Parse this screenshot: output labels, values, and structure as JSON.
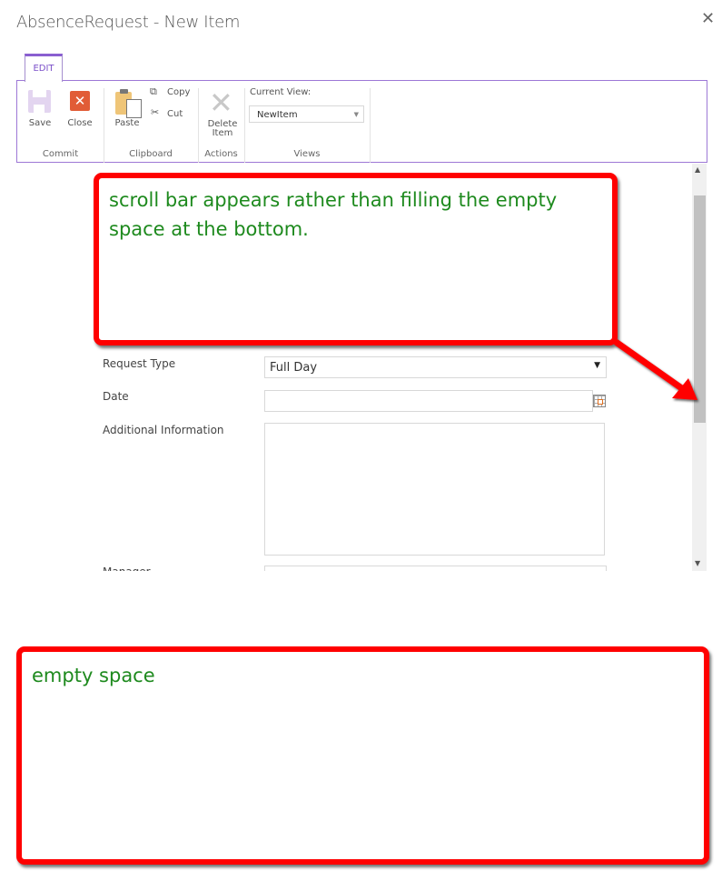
{
  "dialog": {
    "title": "AbsenceRequest - New Item",
    "close_icon": "close-x-icon"
  },
  "ribbon": {
    "active_tab": "EDIT",
    "groups": [
      {
        "label": "Commit",
        "buttons": [
          {
            "label": "Save",
            "icon": "save-icon",
            "enabled": false
          },
          {
            "label": "Close",
            "icon": "close-icon",
            "enabled": true
          }
        ]
      },
      {
        "label": "Clipboard",
        "buttons": [
          {
            "label": "Paste",
            "icon": "paste-icon"
          },
          {
            "label": "Copy",
            "icon": "copy-icon"
          },
          {
            "label": "Cut",
            "icon": "cut-icon"
          }
        ]
      },
      {
        "label": "Actions",
        "buttons": [
          {
            "label": "Delete Item",
            "line1": "Delete",
            "line2": "Item",
            "icon": "delete-icon",
            "enabled": false
          }
        ]
      },
      {
        "label": "Views",
        "current_view_label": "Current View:",
        "current_view_value": "NewItem"
      }
    ]
  },
  "form": {
    "fields": [
      {
        "label": "Request Type",
        "type": "select",
        "value": "Full Day"
      },
      {
        "label": "Date",
        "type": "date",
        "value": ""
      },
      {
        "label": "Additional Information",
        "type": "textarea",
        "value": ""
      },
      {
        "label": "Manager",
        "type": "text",
        "value": ""
      }
    ]
  },
  "annotations": {
    "callout_1": "scroll bar appears rather than filling the empty space at the bottom.",
    "callout_2": "empty space",
    "accent_color": "#ff0000",
    "text_color": "#1e8a1e"
  },
  "colors": {
    "ribbon_border": "#9d78d6",
    "close_button": "#e15c37",
    "paste_icon": "#efc578"
  }
}
